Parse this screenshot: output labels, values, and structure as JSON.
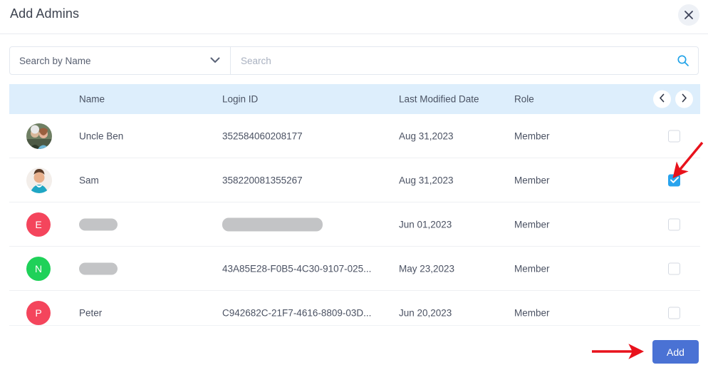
{
  "dialog": {
    "title": "Add Admins",
    "close_icon": "close-icon"
  },
  "search": {
    "filter_selected": "Search by Name",
    "filter_options": [
      "Search by Name"
    ],
    "placeholder": "Search",
    "value": "",
    "search_icon": "search-icon",
    "dropdown_icon": "chevron-down-icon"
  },
  "table": {
    "columns": [
      "Name",
      "Login ID",
      "Last Modified Date",
      "Role"
    ],
    "pager": {
      "prev_icon": "chevron-left-icon",
      "next_icon": "chevron-right-icon"
    },
    "rows": [
      {
        "avatar_type": "photo",
        "avatar_kind": "group-photo",
        "name": "Uncle Ben",
        "name_redacted": false,
        "login_id": "352584060208177",
        "login_redacted": false,
        "date": "Aug 31,2023",
        "role": "Member",
        "checked": false
      },
      {
        "avatar_type": "photo",
        "avatar_kind": "man-photo",
        "name": "Sam",
        "name_redacted": false,
        "login_id": "358220081355267",
        "login_redacted": false,
        "date": "Aug 31,2023",
        "role": "Member",
        "checked": true
      },
      {
        "avatar_type": "letter",
        "avatar_letter": "E",
        "avatar_color": "#f4455c",
        "name": "",
        "name_redacted": true,
        "login_id": "",
        "login_redacted": true,
        "date": "Jun 01,2023",
        "role": "Member",
        "checked": false
      },
      {
        "avatar_type": "letter",
        "avatar_letter": "N",
        "avatar_color": "#1fd159",
        "name": "",
        "name_redacted": true,
        "login_id": "43A85E28-F0B5-4C30-9107-025...",
        "login_redacted": false,
        "date": "May 23,2023",
        "role": "Member",
        "checked": false
      },
      {
        "avatar_type": "letter",
        "avatar_letter": "P",
        "avatar_color": "#f4455c",
        "name": "Peter",
        "name_redacted": false,
        "login_id": "C942682C-21F7-4616-8809-03D...",
        "login_redacted": false,
        "date": "Jun 20,2023",
        "role": "Member",
        "checked": false
      }
    ]
  },
  "footer": {
    "add_label": "Add"
  },
  "annotations": {
    "arrow_color": "#e8121c",
    "arrow_to_checkbox": "red-arrow-pointing-to-checked-checkbox",
    "arrow_to_add": "red-arrow-pointing-to-add-button"
  },
  "colors": {
    "header_bg": "#ddeefc",
    "checkbox_checked": "#29a3ed",
    "add_button": "#4a72d4",
    "search_icon": "#29a3ed"
  }
}
